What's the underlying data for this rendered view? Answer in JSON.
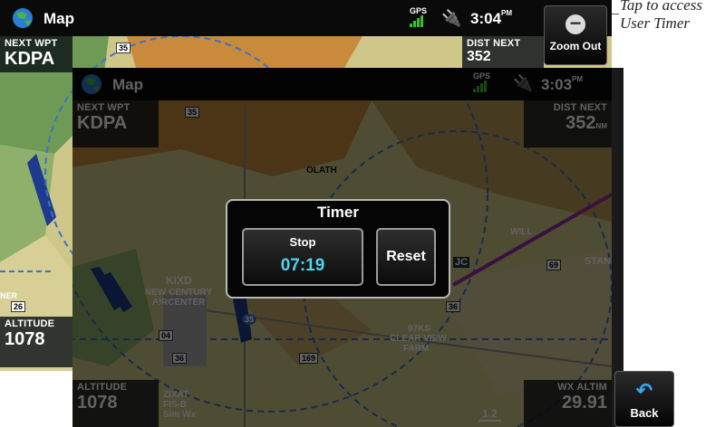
{
  "background_screen": {
    "title": "Map",
    "gps_label": "GPS",
    "clock_time": "3:04",
    "clock_ampm": "PM",
    "next_wpt": {
      "label": "NEXT WPT",
      "value": "KDPA"
    },
    "dist_next": {
      "label": "DIST NEXT",
      "value": "352"
    },
    "altitude": {
      "label": "ALTITUDE",
      "value": "1078"
    },
    "zoom_out_label": "Zoom Out",
    "map_labels": {
      "road_35": "35",
      "road_26": "26",
      "partial_ner": "NER"
    }
  },
  "callout": {
    "line1": "Tap to access",
    "line2": "User Timer"
  },
  "foreground_screen": {
    "title": "Map",
    "gps_label": "GPS",
    "clock_time": "3:03",
    "clock_ampm": "PM",
    "next_wpt": {
      "label": "NEXT WPT",
      "value": "KDPA"
    },
    "dist_next": {
      "label": "DIST NEXT",
      "value": "352",
      "unit": "NM"
    },
    "altitude": {
      "label": "ALTITUDE",
      "value": "1078"
    },
    "wx_altim": {
      "label": "WX ALTIM",
      "value": "29.91"
    },
    "scale": "1.2",
    "back_label": "Back",
    "map_labels": {
      "olath": "OLATH",
      "kixd": "KIXD",
      "new_century": "NEW CENTURY",
      "aircenter": "AIRCENTER",
      "ks97": "97KS",
      "clear_view": "CLEAR VIEW",
      "farm": "FARM",
      "zixat": "ZIXAT",
      "fisb": "FIS-B",
      "simwx": "Sim Wx",
      "stan": "STAN",
      "road_35a": "35",
      "road_35b": "35",
      "road_36a": "36",
      "road_36b": "36",
      "road_169": "169",
      "road_69": "69",
      "road_04": "04",
      "vor_jc": "JC",
      "wpt_will": "WILL"
    }
  },
  "timer": {
    "title": "Timer",
    "stop_label": "Stop",
    "elapsed": "07:19",
    "reset_label": "Reset"
  },
  "colors": {
    "map_tan": "#cfc78a",
    "map_orange": "#c98a3c",
    "map_green": "#6e9a55",
    "airspace_blue": "#3a72c8",
    "timer_cyan": "#53d1ea",
    "course_magenta": "#9a2aa0"
  }
}
